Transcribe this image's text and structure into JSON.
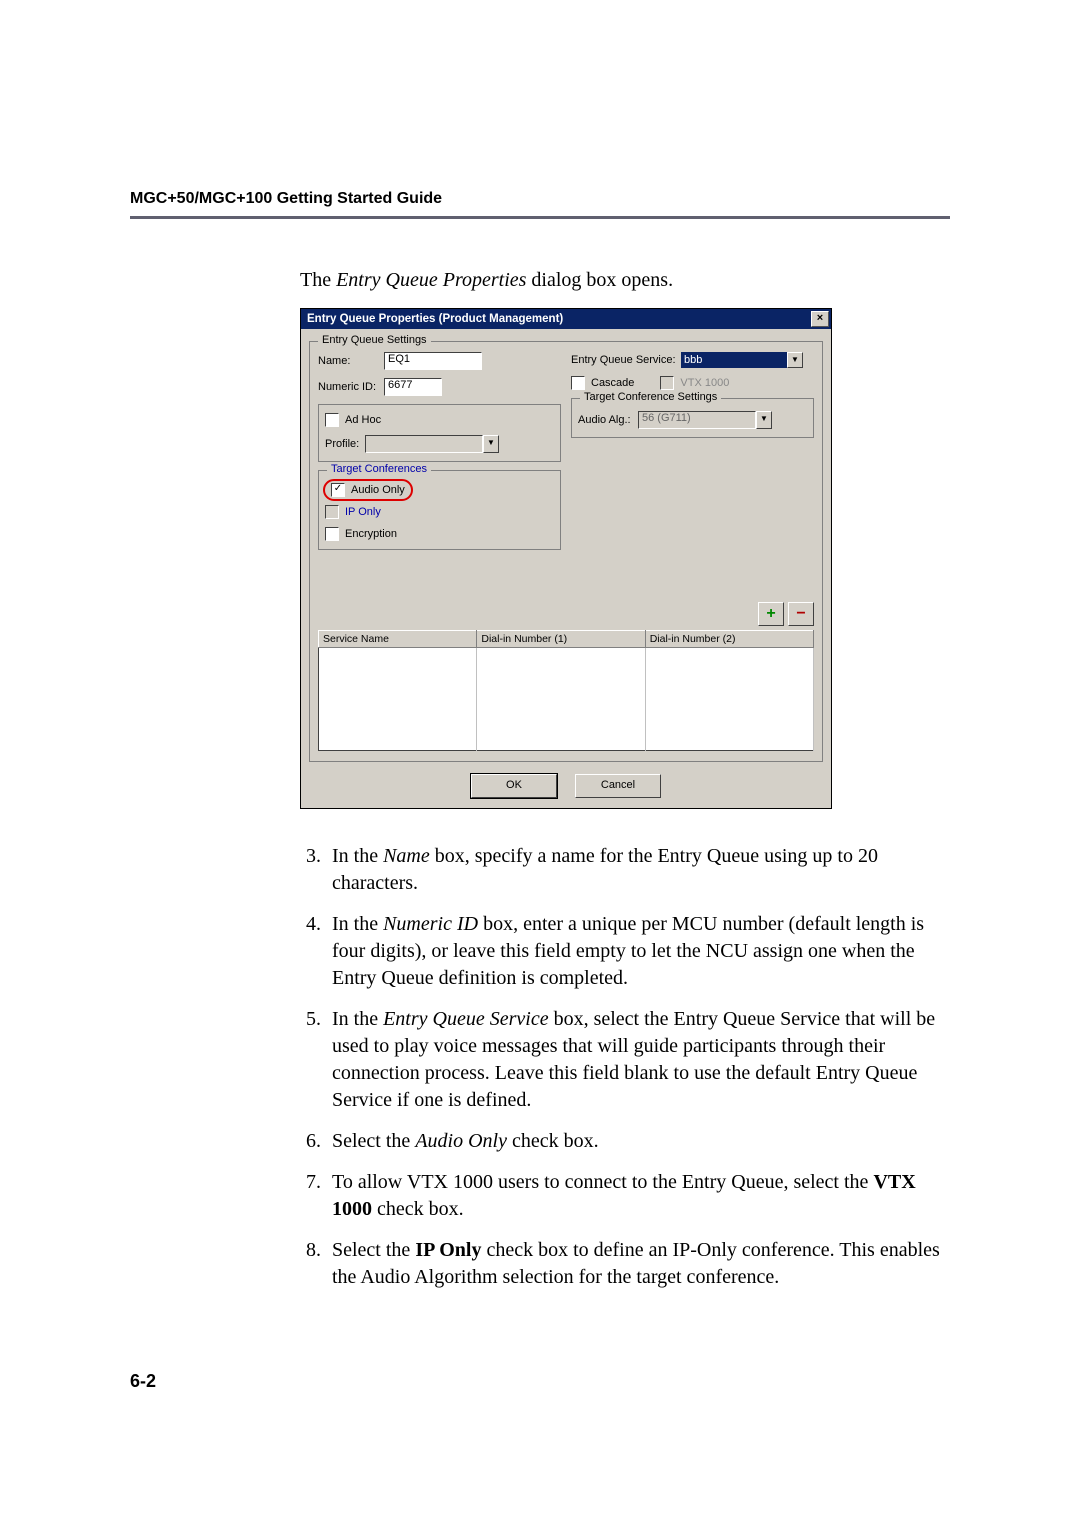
{
  "header": {
    "title": "MGC+50/MGC+100 Getting Started Guide"
  },
  "intro": {
    "pre": "The ",
    "italic": "Entry Queue Properties",
    "post": " dialog box opens."
  },
  "dialog": {
    "title": "Entry Queue Properties (Product Management)",
    "close": "×",
    "grp_settings": "Entry Queue Settings",
    "name_lbl": "Name:",
    "name_val": "EQ1",
    "numid_lbl": "Numeric ID:",
    "numid_val": "6677",
    "adhoc": "Ad Hoc",
    "profile_lbl": "Profile:",
    "profile_val": "",
    "target_conf_legend": "Target Conferences",
    "audio_only": "Audio Only",
    "ip_only": "IP Only",
    "encryption": "Encryption",
    "eqs_lbl": "Entry Queue Service:",
    "eqs_val": "bbb",
    "cascade": "Cascade",
    "vtx": "VTX 1000",
    "tcs_legend": "Target Conference Settings",
    "audio_alg_lbl": "Audio Alg.:",
    "audio_alg_val": "56 (G711)",
    "col_service": "Service Name",
    "col_d1": "Dial-in Number (1)",
    "col_d2": "Dial-in Number (2)",
    "ok": "OK",
    "cancel": "Cancel"
  },
  "steps": {
    "3": {
      "pre": "In the ",
      "it": "Name",
      "post": " box, specify a name for the Entry Queue using up to 20 characters."
    },
    "4": {
      "pre": "In the ",
      "it": "Numeric ID",
      "post": " box, enter a unique per MCU number (default length is four digits), or leave this field empty to let the NCU assign one when the Entry Queue definition is completed."
    },
    "5": {
      "pre": "In the ",
      "it": "Entry Queue Service",
      "post": " box, select the Entry Queue Service that will be used to play voice messages that will guide participants through their connection process. Leave this field blank to use the default Entry Queue Service if one is defined."
    },
    "6": {
      "pre": "Select the ",
      "it": "Audio Only",
      "post": " check box."
    },
    "7": {
      "pre": "To allow VTX 1000 users to connect to the Entry Queue, select the ",
      "b": "VTX 1000",
      "post": " check box."
    },
    "8": {
      "pre": "Select the ",
      "b": "IP Only",
      "post": " check box to define an IP-Only conference. This enables the Audio Algorithm selection for the target conference."
    }
  },
  "page_num": "6-2"
}
